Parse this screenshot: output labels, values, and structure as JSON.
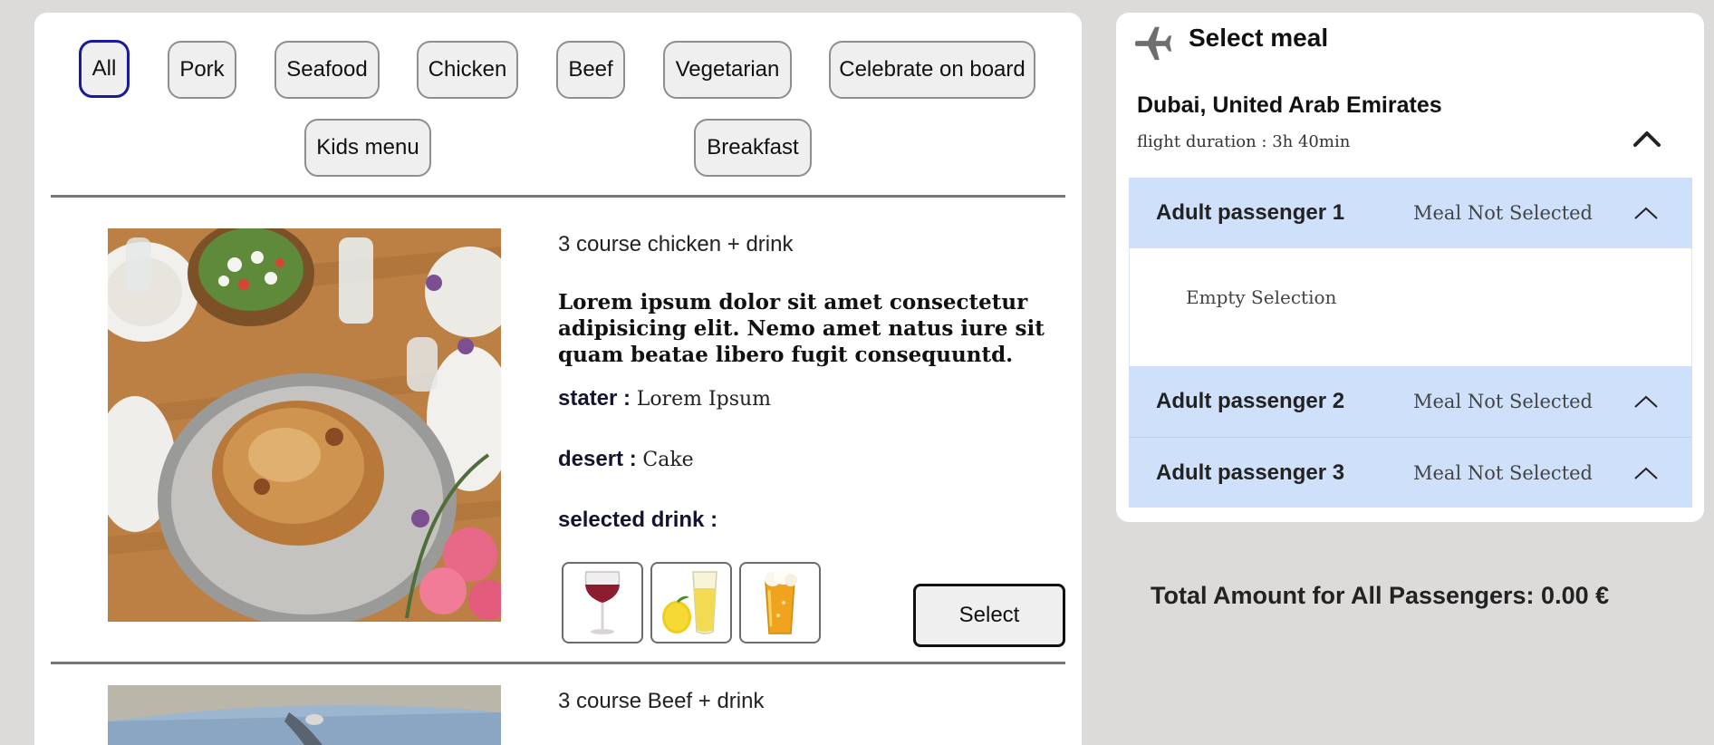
{
  "filters": [
    {
      "label": "All",
      "active": true
    },
    {
      "label": "Pork",
      "active": false
    },
    {
      "label": "Seafood",
      "active": false
    },
    {
      "label": "Chicken",
      "active": false
    },
    {
      "label": "Beef",
      "active": false
    },
    {
      "label": "Vegetarian",
      "active": false
    },
    {
      "label": "Celebrate on board",
      "active": false
    },
    {
      "label": "Kids menu",
      "active": false
    },
    {
      "label": "Breakfast",
      "active": false
    }
  ],
  "meals": [
    {
      "title": "3 course chicken + drink",
      "description": "Lorem ipsum dolor sit amet consectetur adipisicing elit. Nemo amet natus iure sit quam beatae libero fugit consequuntd.",
      "starter_label": "stater :",
      "starter_value": "Lorem Ipsum",
      "dessert_label": "desert :",
      "dessert_value": "Cake",
      "drink_label": "selected drink :",
      "drinks": [
        "wine-glass-icon",
        "lemonade-icon",
        "beer-icon"
      ],
      "select_label": "Select"
    },
    {
      "title": "3 course Beef + drink"
    }
  ],
  "sidebar": {
    "title": "Select meal",
    "destination": "Dubai, United Arab Emirates",
    "duration": "flight duration : 3h 40min",
    "passengers": [
      {
        "name": "Adult passenger 1",
        "status": "Meal Not Selected",
        "expanded": true,
        "body": "Empty Selection"
      },
      {
        "name": "Adult passenger 2",
        "status": "Meal Not Selected",
        "expanded": false
      },
      {
        "name": "Adult passenger 3",
        "status": "Meal Not Selected",
        "expanded": false
      }
    ]
  },
  "total": "Total Amount for All Passengers: 0.00 €",
  "colors": {
    "background": "#dcdbda",
    "accent_active_border": "#1a1a9e",
    "passenger_row": "#cfe0fb"
  }
}
